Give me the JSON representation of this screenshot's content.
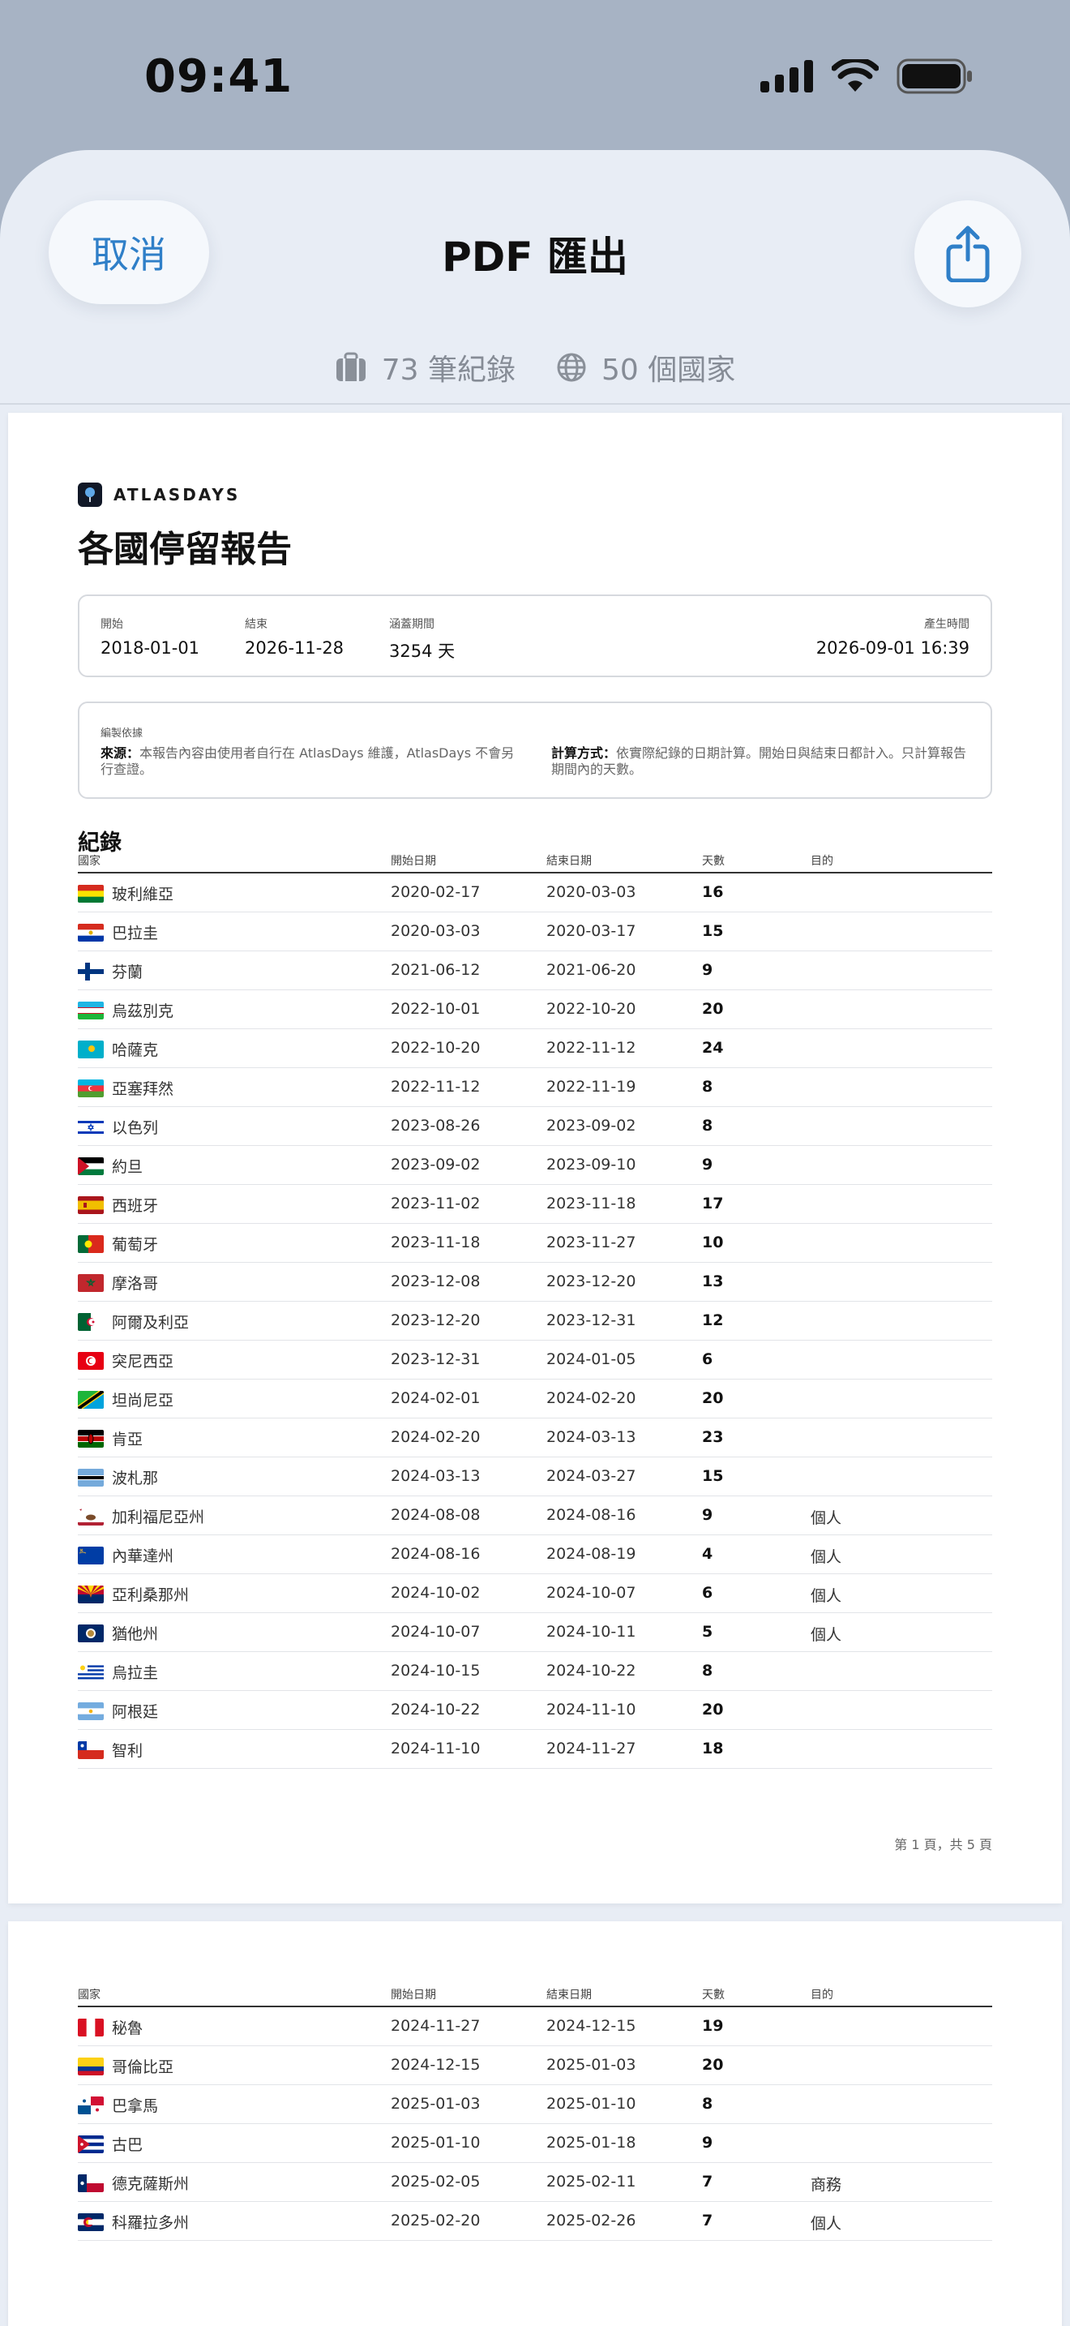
{
  "status_bar": {
    "time": "09:41"
  },
  "nav": {
    "cancel_label": "取消",
    "title": "PDF 匯出"
  },
  "summary": {
    "records": "73 筆紀錄",
    "countries": "50 個國家"
  },
  "report": {
    "brand": "ATLASDAYS",
    "title": "各國停留報告",
    "meta": {
      "start_label": "開始",
      "start_value": "2018-01-01",
      "end_label": "結束",
      "end_value": "2026-11-28",
      "period_label": "涵蓋期間",
      "period_value": "3254 天",
      "generated_label": "產生時間",
      "generated_value": "2026-09-01 16:39"
    },
    "basis": {
      "label": "編製依據",
      "source_bold": "來源：",
      "source_text": "本報告內容由使用者自行在 AtlasDays 維護，AtlasDays 不會另行查證。",
      "method_bold": "計算方式：",
      "method_text": "依實際紀錄的日期計算。開始日與結束日都計入。只計算報告期間內的天數。"
    },
    "section_title": "紀錄",
    "columns": {
      "country": "國家",
      "start": "開始日期",
      "end": "結束日期",
      "days": "天數",
      "purpose": "目的"
    },
    "rows_page1": [
      {
        "country": "玻利維亞",
        "start": "2020-02-17",
        "end": "2020-03-03",
        "days": "16",
        "purpose": "",
        "flag": "bolivia"
      },
      {
        "country": "巴拉圭",
        "start": "2020-03-03",
        "end": "2020-03-17",
        "days": "15",
        "purpose": "",
        "flag": "paraguay"
      },
      {
        "country": "芬蘭",
        "start": "2021-06-12",
        "end": "2021-06-20",
        "days": "9",
        "purpose": "",
        "flag": "finland"
      },
      {
        "country": "烏茲別克",
        "start": "2022-10-01",
        "end": "2022-10-20",
        "days": "20",
        "purpose": "",
        "flag": "uzbekistan"
      },
      {
        "country": "哈薩克",
        "start": "2022-10-20",
        "end": "2022-11-12",
        "days": "24",
        "purpose": "",
        "flag": "kazakhstan"
      },
      {
        "country": "亞塞拜然",
        "start": "2022-11-12",
        "end": "2022-11-19",
        "days": "8",
        "purpose": "",
        "flag": "azerbaijan"
      },
      {
        "country": "以色列",
        "start": "2023-08-26",
        "end": "2023-09-02",
        "days": "8",
        "purpose": "",
        "flag": "israel"
      },
      {
        "country": "約旦",
        "start": "2023-09-02",
        "end": "2023-09-10",
        "days": "9",
        "purpose": "",
        "flag": "jordan"
      },
      {
        "country": "西班牙",
        "start": "2023-11-02",
        "end": "2023-11-18",
        "days": "17",
        "purpose": "",
        "flag": "spain"
      },
      {
        "country": "葡萄牙",
        "start": "2023-11-18",
        "end": "2023-11-27",
        "days": "10",
        "purpose": "",
        "flag": "portugal"
      },
      {
        "country": "摩洛哥",
        "start": "2023-12-08",
        "end": "2023-12-20",
        "days": "13",
        "purpose": "",
        "flag": "morocco"
      },
      {
        "country": "阿爾及利亞",
        "start": "2023-12-20",
        "end": "2023-12-31",
        "days": "12",
        "purpose": "",
        "flag": "algeria"
      },
      {
        "country": "突尼西亞",
        "start": "2023-12-31",
        "end": "2024-01-05",
        "days": "6",
        "purpose": "",
        "flag": "tunisia"
      },
      {
        "country": "坦尚尼亞",
        "start": "2024-02-01",
        "end": "2024-02-20",
        "days": "20",
        "purpose": "",
        "flag": "tanzania"
      },
      {
        "country": "肯亞",
        "start": "2024-02-20",
        "end": "2024-03-13",
        "days": "23",
        "purpose": "",
        "flag": "kenya"
      },
      {
        "country": "波札那",
        "start": "2024-03-13",
        "end": "2024-03-27",
        "days": "15",
        "purpose": "",
        "flag": "botswana"
      },
      {
        "country": "加利福尼亞州",
        "start": "2024-08-08",
        "end": "2024-08-16",
        "days": "9",
        "purpose": "個人",
        "flag": "california"
      },
      {
        "country": "內華達州",
        "start": "2024-08-16",
        "end": "2024-08-19",
        "days": "4",
        "purpose": "個人",
        "flag": "nevada"
      },
      {
        "country": "亞利桑那州",
        "start": "2024-10-02",
        "end": "2024-10-07",
        "days": "6",
        "purpose": "個人",
        "flag": "arizona"
      },
      {
        "country": "猶他州",
        "start": "2024-10-07",
        "end": "2024-10-11",
        "days": "5",
        "purpose": "個人",
        "flag": "utah"
      },
      {
        "country": "烏拉圭",
        "start": "2024-10-15",
        "end": "2024-10-22",
        "days": "8",
        "purpose": "",
        "flag": "uruguay"
      },
      {
        "country": "阿根廷",
        "start": "2024-10-22",
        "end": "2024-11-10",
        "days": "20",
        "purpose": "",
        "flag": "argentina"
      },
      {
        "country": "智利",
        "start": "2024-11-10",
        "end": "2024-11-27",
        "days": "18",
        "purpose": "",
        "flag": "chile"
      }
    ],
    "rows_page2": [
      {
        "country": "秘魯",
        "start": "2024-11-27",
        "end": "2024-12-15",
        "days": "19",
        "purpose": "",
        "flag": "peru"
      },
      {
        "country": "哥倫比亞",
        "start": "2024-12-15",
        "end": "2025-01-03",
        "days": "20",
        "purpose": "",
        "flag": "colombia"
      },
      {
        "country": "巴拿馬",
        "start": "2025-01-03",
        "end": "2025-01-10",
        "days": "8",
        "purpose": "",
        "flag": "panama"
      },
      {
        "country": "古巴",
        "start": "2025-01-10",
        "end": "2025-01-18",
        "days": "9",
        "purpose": "",
        "flag": "cuba"
      },
      {
        "country": "德克薩斯州",
        "start": "2025-02-05",
        "end": "2025-02-11",
        "days": "7",
        "purpose": "商務",
        "flag": "texas"
      },
      {
        "country": "科羅拉多州",
        "start": "2025-02-20",
        "end": "2025-02-26",
        "days": "7",
        "purpose": "個人",
        "flag": "colorado"
      }
    ],
    "page_footer": "第 1 頁，共 5 頁"
  },
  "colors": {
    "accent": "#2f7fc8",
    "sheet": "#e8edf5",
    "backdrop": "#a7b3c4"
  }
}
